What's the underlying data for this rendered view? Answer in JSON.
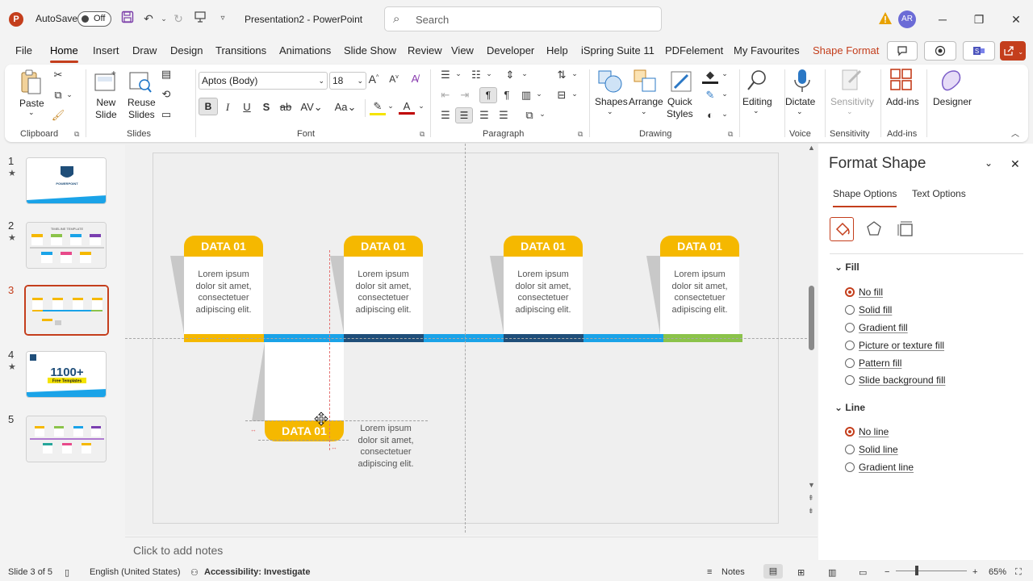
{
  "titlebar": {
    "autosave_label": "AutoSave",
    "autosave_state": "Off",
    "doc_title": "Presentation2  -  PowerPoint",
    "search_placeholder": "Search",
    "user_initials": "AR"
  },
  "menu": {
    "tabs": [
      "File",
      "Home",
      "Insert",
      "Draw",
      "Design",
      "Transitions",
      "Animations",
      "Slide Show",
      "Review",
      "View",
      "Developer",
      "Help",
      "iSpring Suite 11",
      "PDFelement",
      "My Favourites",
      "Shape Format"
    ],
    "active": "Home"
  },
  "ribbon": {
    "clipboard": {
      "paste": "Paste",
      "label": "Clipboard"
    },
    "slides": {
      "new_slide": "New\nSlide",
      "reuse_slides": "Reuse\nSlides",
      "label": "Slides"
    },
    "font": {
      "name": "Aptos (Body)",
      "size": "18",
      "label": "Font"
    },
    "paragraph": {
      "label": "Paragraph"
    },
    "drawing": {
      "shapes": "Shapes",
      "arrange": "Arrange",
      "quick_styles": "Quick\nStyles",
      "label": "Drawing"
    },
    "editing": {
      "label_btn": "Editing"
    },
    "voice": {
      "dictate": "Dictate",
      "label": "Voice"
    },
    "sensitivity": {
      "btn": "Sensitivity",
      "label": "Sensitivity"
    },
    "addins": {
      "btn": "Add-ins",
      "label": "Add-ins"
    },
    "designer": {
      "btn": "Designer"
    }
  },
  "thumbnails": [
    {
      "num": "1",
      "star": true,
      "title": "POWERPOINT"
    },
    {
      "num": "2",
      "star": true,
      "title": "TIMELINE TEMPLATE"
    },
    {
      "num": "3",
      "star": false,
      "active": true
    },
    {
      "num": "4",
      "star": true,
      "title": "1100+",
      "subtitle": "Free Templates"
    },
    {
      "num": "5",
      "star": false
    }
  ],
  "slide": {
    "cards": [
      {
        "title": "DATA 01",
        "text": "Lorem ipsum dolor sit amet, consectetuer adipiscing elit."
      },
      {
        "title": "DATA 01",
        "text": "Lorem ipsum dolor sit amet, consectetuer adipiscing elit."
      },
      {
        "title": "DATA 01",
        "text": "Lorem ipsum dolor sit amet, consectetuer adipiscing elit."
      },
      {
        "title": "DATA 01",
        "text": "Lorem ipsum dolor sit amet, consectetuer adipiscing elit."
      }
    ],
    "moving_card": {
      "title": "DATA 01",
      "text": "Lorem ipsum dolor sit amet, consectetuer adipiscing elit."
    },
    "colors": {
      "yellow": "#f5b800",
      "blue": "#1aa3e8",
      "navy": "#1f4e79",
      "green": "#8bc34a",
      "accent": "#c43e1c"
    }
  },
  "notes_placeholder": "Click to add notes",
  "format_pane": {
    "title": "Format Shape",
    "tabs": [
      "Shape Options",
      "Text Options"
    ],
    "fill_section": "Fill",
    "fill_options": [
      "No fill",
      "Solid fill",
      "Gradient fill",
      "Picture or texture fill",
      "Pattern fill",
      "Slide background fill"
    ],
    "fill_selected": "No fill",
    "line_section": "Line",
    "line_options": [
      "No line",
      "Solid line",
      "Gradient line"
    ],
    "line_selected": "No line"
  },
  "status": {
    "slide_info": "Slide 3 of 5",
    "language": "English (United States)",
    "accessibility": "Accessibility: Investigate",
    "notes": "Notes",
    "zoom": "65%"
  }
}
